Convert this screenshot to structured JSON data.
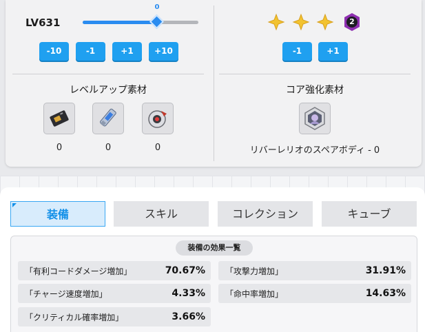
{
  "level": {
    "label": "LV631",
    "slider_value": "0",
    "slider_fraction": 0.64
  },
  "level_buttons": [
    "-10",
    "-1",
    "+1",
    "+10"
  ],
  "core": {
    "stars": 3,
    "badge": "2",
    "buttons": [
      "-1",
      "+1"
    ],
    "title": "コア強化素材",
    "material_name": "リバーレリオのスペアボディ - 0"
  },
  "levelup": {
    "title": "レベルアップ素材",
    "materials": [
      {
        "icon": "card-chip-icon",
        "count": "0"
      },
      {
        "icon": "usb-drive-icon",
        "count": "0"
      },
      {
        "icon": "sphere-module-icon",
        "count": "0"
      }
    ]
  },
  "tabs": [
    "装備",
    "スキル",
    "コレクション",
    "キューブ"
  ],
  "active_tab": 0,
  "effects": {
    "title": "装備の効果一覧",
    "stats": [
      {
        "name": "「有利コードダメージ増加」",
        "value": "70.67%"
      },
      {
        "name": "「攻撃力増加」",
        "value": "31.91%"
      },
      {
        "name": "「チャージ速度増加」",
        "value": "4.33%"
      },
      {
        "name": "「命中率増加」",
        "value": "14.63%"
      },
      {
        "name": "「クリティカル確率増加」",
        "value": "3.66%"
      }
    ]
  },
  "colors": {
    "accent": "#1fa0f0",
    "star": "#f2c330",
    "badge": "#8e2fb0"
  }
}
